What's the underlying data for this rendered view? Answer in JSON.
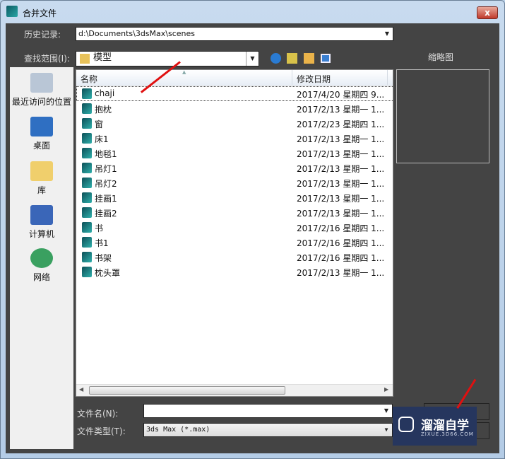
{
  "window": {
    "title": "合并文件",
    "close": "x"
  },
  "history": {
    "label": "历史记录:",
    "value": "d:\\Documents\\3dsMax\\scenes"
  },
  "lookin": {
    "label": "查找范围(I):",
    "value": "模型"
  },
  "thumbnail_label": "缩略图",
  "places": [
    {
      "label": "最近访问的位置"
    },
    {
      "label": "桌面"
    },
    {
      "label": "库"
    },
    {
      "label": "计算机"
    },
    {
      "label": "网络"
    }
  ],
  "columns": {
    "name": "名称",
    "date": "修改日期"
  },
  "files": [
    {
      "name": "chaji",
      "date": "2017/4/20 星期四 9..."
    },
    {
      "name": "抱枕",
      "date": "2017/2/13 星期一 1..."
    },
    {
      "name": "窗",
      "date": "2017/2/23 星期四 1..."
    },
    {
      "name": "床1",
      "date": "2017/2/13 星期一 1..."
    },
    {
      "name": "地毯1",
      "date": "2017/2/13 星期一 1..."
    },
    {
      "name": "吊灯1",
      "date": "2017/2/13 星期一 1..."
    },
    {
      "name": "吊灯2",
      "date": "2017/2/13 星期一 1..."
    },
    {
      "name": "挂画1",
      "date": "2017/2/13 星期一 1..."
    },
    {
      "name": "挂画2",
      "date": "2017/2/13 星期一 1..."
    },
    {
      "name": "书",
      "date": "2017/2/16 星期四 1..."
    },
    {
      "name": "书1",
      "date": "2017/2/16 星期四 1..."
    },
    {
      "name": "书架",
      "date": "2017/2/16 星期四 1..."
    },
    {
      "name": "枕头罩",
      "date": "2017/2/13 星期一 1..."
    }
  ],
  "filename": {
    "label": "文件名(N):",
    "value": ""
  },
  "filetype": {
    "label": "文件类型(T):",
    "value": "3ds Max (*.max)"
  },
  "watermark": {
    "title": "溜溜自学",
    "url": "ZIXUE.3D66.COM"
  }
}
